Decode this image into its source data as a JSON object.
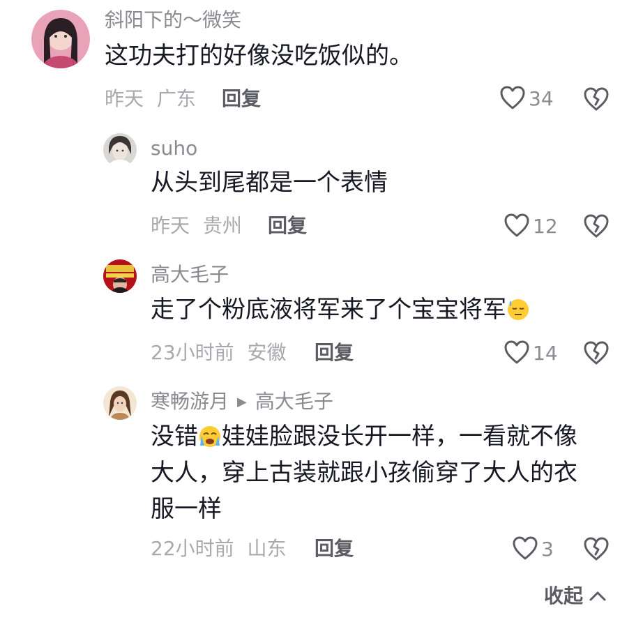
{
  "comments": [
    {
      "username": "斜阳下的～微笑",
      "text": "这功夫打的好像没吃饭似的。",
      "time": "昨天",
      "location": "广东",
      "reply_label": "回复",
      "likes": "34",
      "avatar_icon": "avatar-photo"
    },
    {
      "username": "suho",
      "text": "从头到尾都是一个表情",
      "time": "昨天",
      "location": "贵州",
      "reply_label": "回复",
      "likes": "12",
      "avatar_icon": "avatar-photo"
    },
    {
      "username": "高大毛子",
      "text": "走了个粉底液将军来了个宝宝将军",
      "emoji": "sweat-face",
      "time": "23小时前",
      "location": "安徽",
      "reply_label": "回复",
      "likes": "14",
      "avatar_icon": "avatar-photo"
    },
    {
      "username": "寒畅游月",
      "reply_to": "高大毛子",
      "text_line1_a": "没错",
      "emoji": "crying-face",
      "text_line1_b": "娃娃脸跟没长开一样，一看就不像",
      "text_line2": "大人，穿上古装就跟小孩偷穿了大人的衣",
      "text_line3": "服一样",
      "time": "22小时前",
      "location": "山东",
      "reply_label": "回复",
      "likes": "3",
      "avatar_icon": "avatar-photo"
    }
  ],
  "collapse_label": "收起",
  "colors": {
    "text": "#161823",
    "username": "#8a8b91",
    "meta": "#a8a9ae",
    "reply": "#5b5c63"
  }
}
